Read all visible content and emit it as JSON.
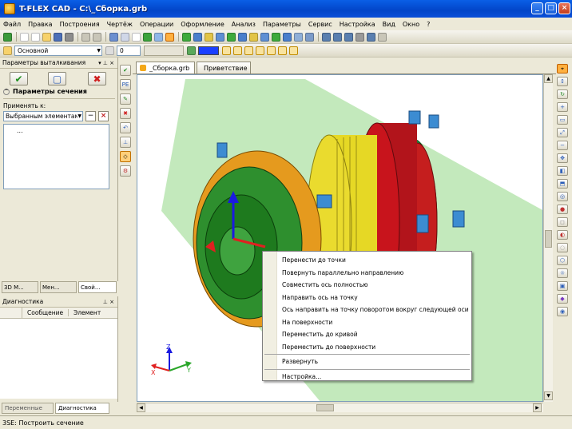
{
  "window": {
    "title": "T-FLEX CAD - C:\\_Сборка.grb",
    "controls": [
      "_",
      "□",
      "×"
    ]
  },
  "menu": [
    "Файл",
    "Правка",
    "Построения",
    "Чертёж",
    "Операции",
    "Оформление",
    "Анализ",
    "Параметры",
    "Сервис",
    "Настройка",
    "Вид",
    "Окно",
    "?"
  ],
  "toolbar2": {
    "layer_select": "Основной",
    "level_value": "0"
  },
  "left_panel": {
    "header": "Параметры выталкивания",
    "section_title": "Параметры сечения",
    "apply_label": "Применять к:",
    "apply_select": "Выбранным элементам",
    "list_item": "...",
    "buttons": [
      "✔",
      "▢",
      "✖"
    ]
  },
  "panel_tabs": [
    "3D М...",
    "Мен...",
    "Свой..."
  ],
  "diagnostics": {
    "title": "Диагностика",
    "columns": [
      "Сообщение",
      "Элемент"
    ],
    "bottom_tabs": [
      "Переменные",
      "Диагностика"
    ]
  },
  "doc_tabs": [
    "_Сборка.grb",
    "Приветствие"
  ],
  "context_menu": {
    "group1": [
      "Перенести до точки",
      "Повернуть параллельно направлению",
      "Совместить ось полностью",
      "Направить ось на точку",
      "Ось направить на точку поворотом вокруг следующей оси",
      "На поверхности",
      "Переместить до кривой",
      "Переместить до поверхности"
    ],
    "group2": [
      "Развернуть"
    ],
    "group3": [
      "Настройка..."
    ]
  },
  "axes": {
    "x": "X",
    "y": "Y",
    "z": "Z"
  },
  "status": "3SE: Построить сечение",
  "colors": {
    "titlebar": "#0A4FD8",
    "accent": "#FFA500",
    "gear_red": "#B2141B",
    "gear_yellow": "#E6D825",
    "gear_green": "#2E9B2A",
    "plane": "#A9E09F"
  }
}
